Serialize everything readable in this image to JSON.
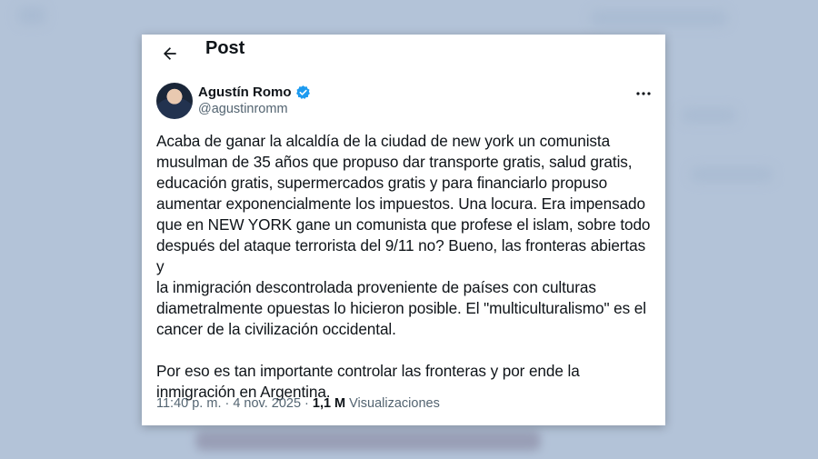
{
  "header": {
    "title": "Post"
  },
  "author": {
    "display_name": "Agustín Romo",
    "handle": "@agustinromm",
    "verified": true
  },
  "tweet": {
    "paragraphs": [
      "Acaba de ganar la alcaldía de la ciudad de new york un comunista\nmusulman de 35 años que propuso dar transporte gratis, salud gratis,\neducación gratis, supermercados gratis y para financiarlo propuso\naumentar exponencialmente los impuestos. Una locura. Era impensado\nque en NEW YORK gane un comunista que profese el islam, sobre todo\ndespués del ataque terrorista del 9/11 no? Bueno, las fronteras abiertas y\nla inmigración descontrolada proveniente de países con culturas\ndiametralmente opuestas lo hicieron posible. El \"multiculturalismo\" es el\ncancer de la civilización occidental.",
      "Por eso es tan importante controlar las fronteras y por ende la\ninmigración en Argentina."
    ]
  },
  "meta": {
    "time": "11:40 p. m.",
    "separator1": "·",
    "date": "4 nov. 2025",
    "separator2": "·",
    "views_count": "1,1 M",
    "views_label": "Visualizaciones"
  },
  "icons": {
    "back": "arrow-left-icon",
    "verified": "verified-badge-icon",
    "more": "more-dots-icon"
  },
  "colors": {
    "background": "#b3c3d8",
    "card": "#ffffff",
    "text": "#0f1419",
    "secondary_text": "#536471",
    "verified_blue": "#1d9bf0"
  }
}
